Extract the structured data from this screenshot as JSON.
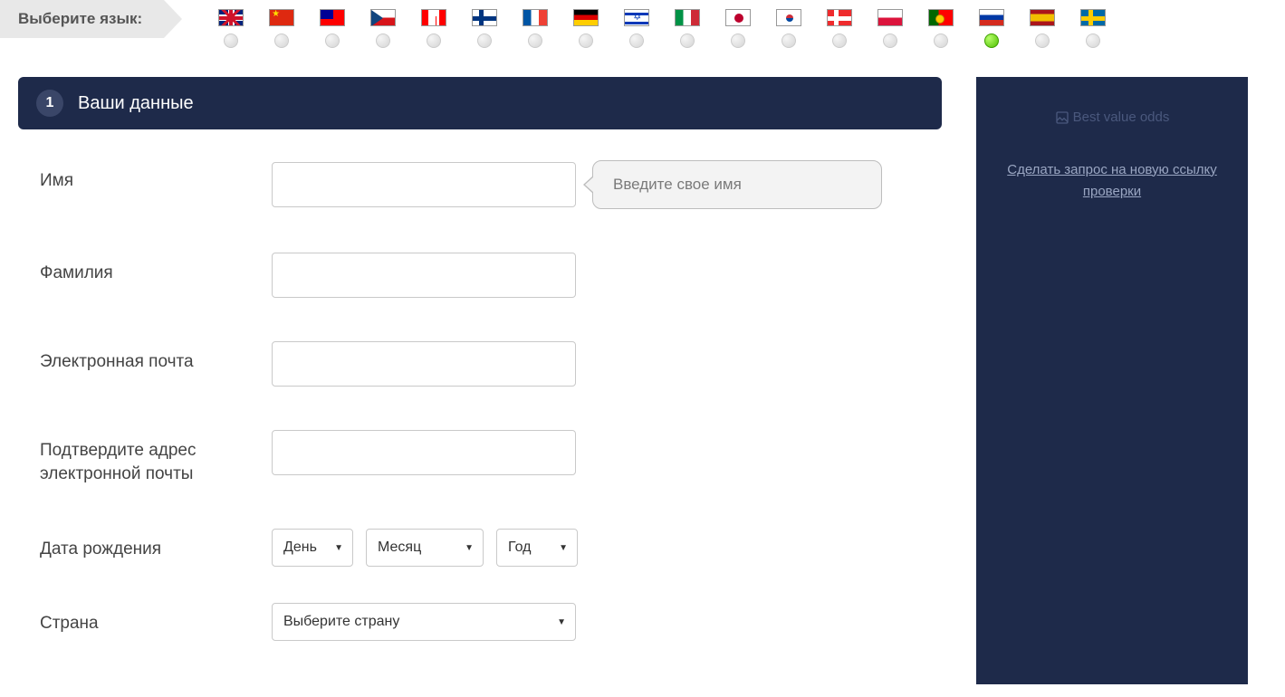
{
  "language_bar": {
    "label": "Выберите язык:",
    "flags": [
      {
        "code": "uk",
        "name": "flag-uk-icon"
      },
      {
        "code": "cn",
        "name": "flag-cn-icon"
      },
      {
        "code": "tw",
        "name": "flag-tw-icon"
      },
      {
        "code": "cz",
        "name": "flag-cz-icon"
      },
      {
        "code": "ca",
        "name": "flag-ca-icon"
      },
      {
        "code": "fi",
        "name": "flag-fi-icon"
      },
      {
        "code": "fr",
        "name": "flag-fr-icon"
      },
      {
        "code": "de",
        "name": "flag-de-icon"
      },
      {
        "code": "il",
        "name": "flag-il-icon"
      },
      {
        "code": "it",
        "name": "flag-it-icon"
      },
      {
        "code": "jp",
        "name": "flag-jp-icon"
      },
      {
        "code": "kr",
        "name": "flag-kr-icon"
      },
      {
        "code": "no",
        "name": "flag-no-icon"
      },
      {
        "code": "pl",
        "name": "flag-pl-icon"
      },
      {
        "code": "pt",
        "name": "flag-pt-icon"
      },
      {
        "code": "ru",
        "name": "flag-ru-icon",
        "selected": true
      },
      {
        "code": "es",
        "name": "flag-es-icon"
      },
      {
        "code": "se",
        "name": "flag-se-icon"
      }
    ]
  },
  "form_header": {
    "step": "1",
    "title": "Ваши данные"
  },
  "form": {
    "first_name": {
      "label": "Имя",
      "value": "",
      "hint": "Введите свое имя"
    },
    "last_name": {
      "label": "Фамилия",
      "value": ""
    },
    "email": {
      "label": "Электронная почта",
      "value": ""
    },
    "email_confirm": {
      "label": "Подтвердите адрес электронной почты",
      "value": ""
    },
    "dob": {
      "label": "Дата рождения",
      "day": "День",
      "month": "Месяц",
      "year": "Год"
    },
    "country": {
      "label": "Страна",
      "placeholder": "Выберите страну"
    }
  },
  "sidebar": {
    "image_alt": "Best value odds",
    "link": "Сделать запрос на новую ссылку проверки"
  }
}
